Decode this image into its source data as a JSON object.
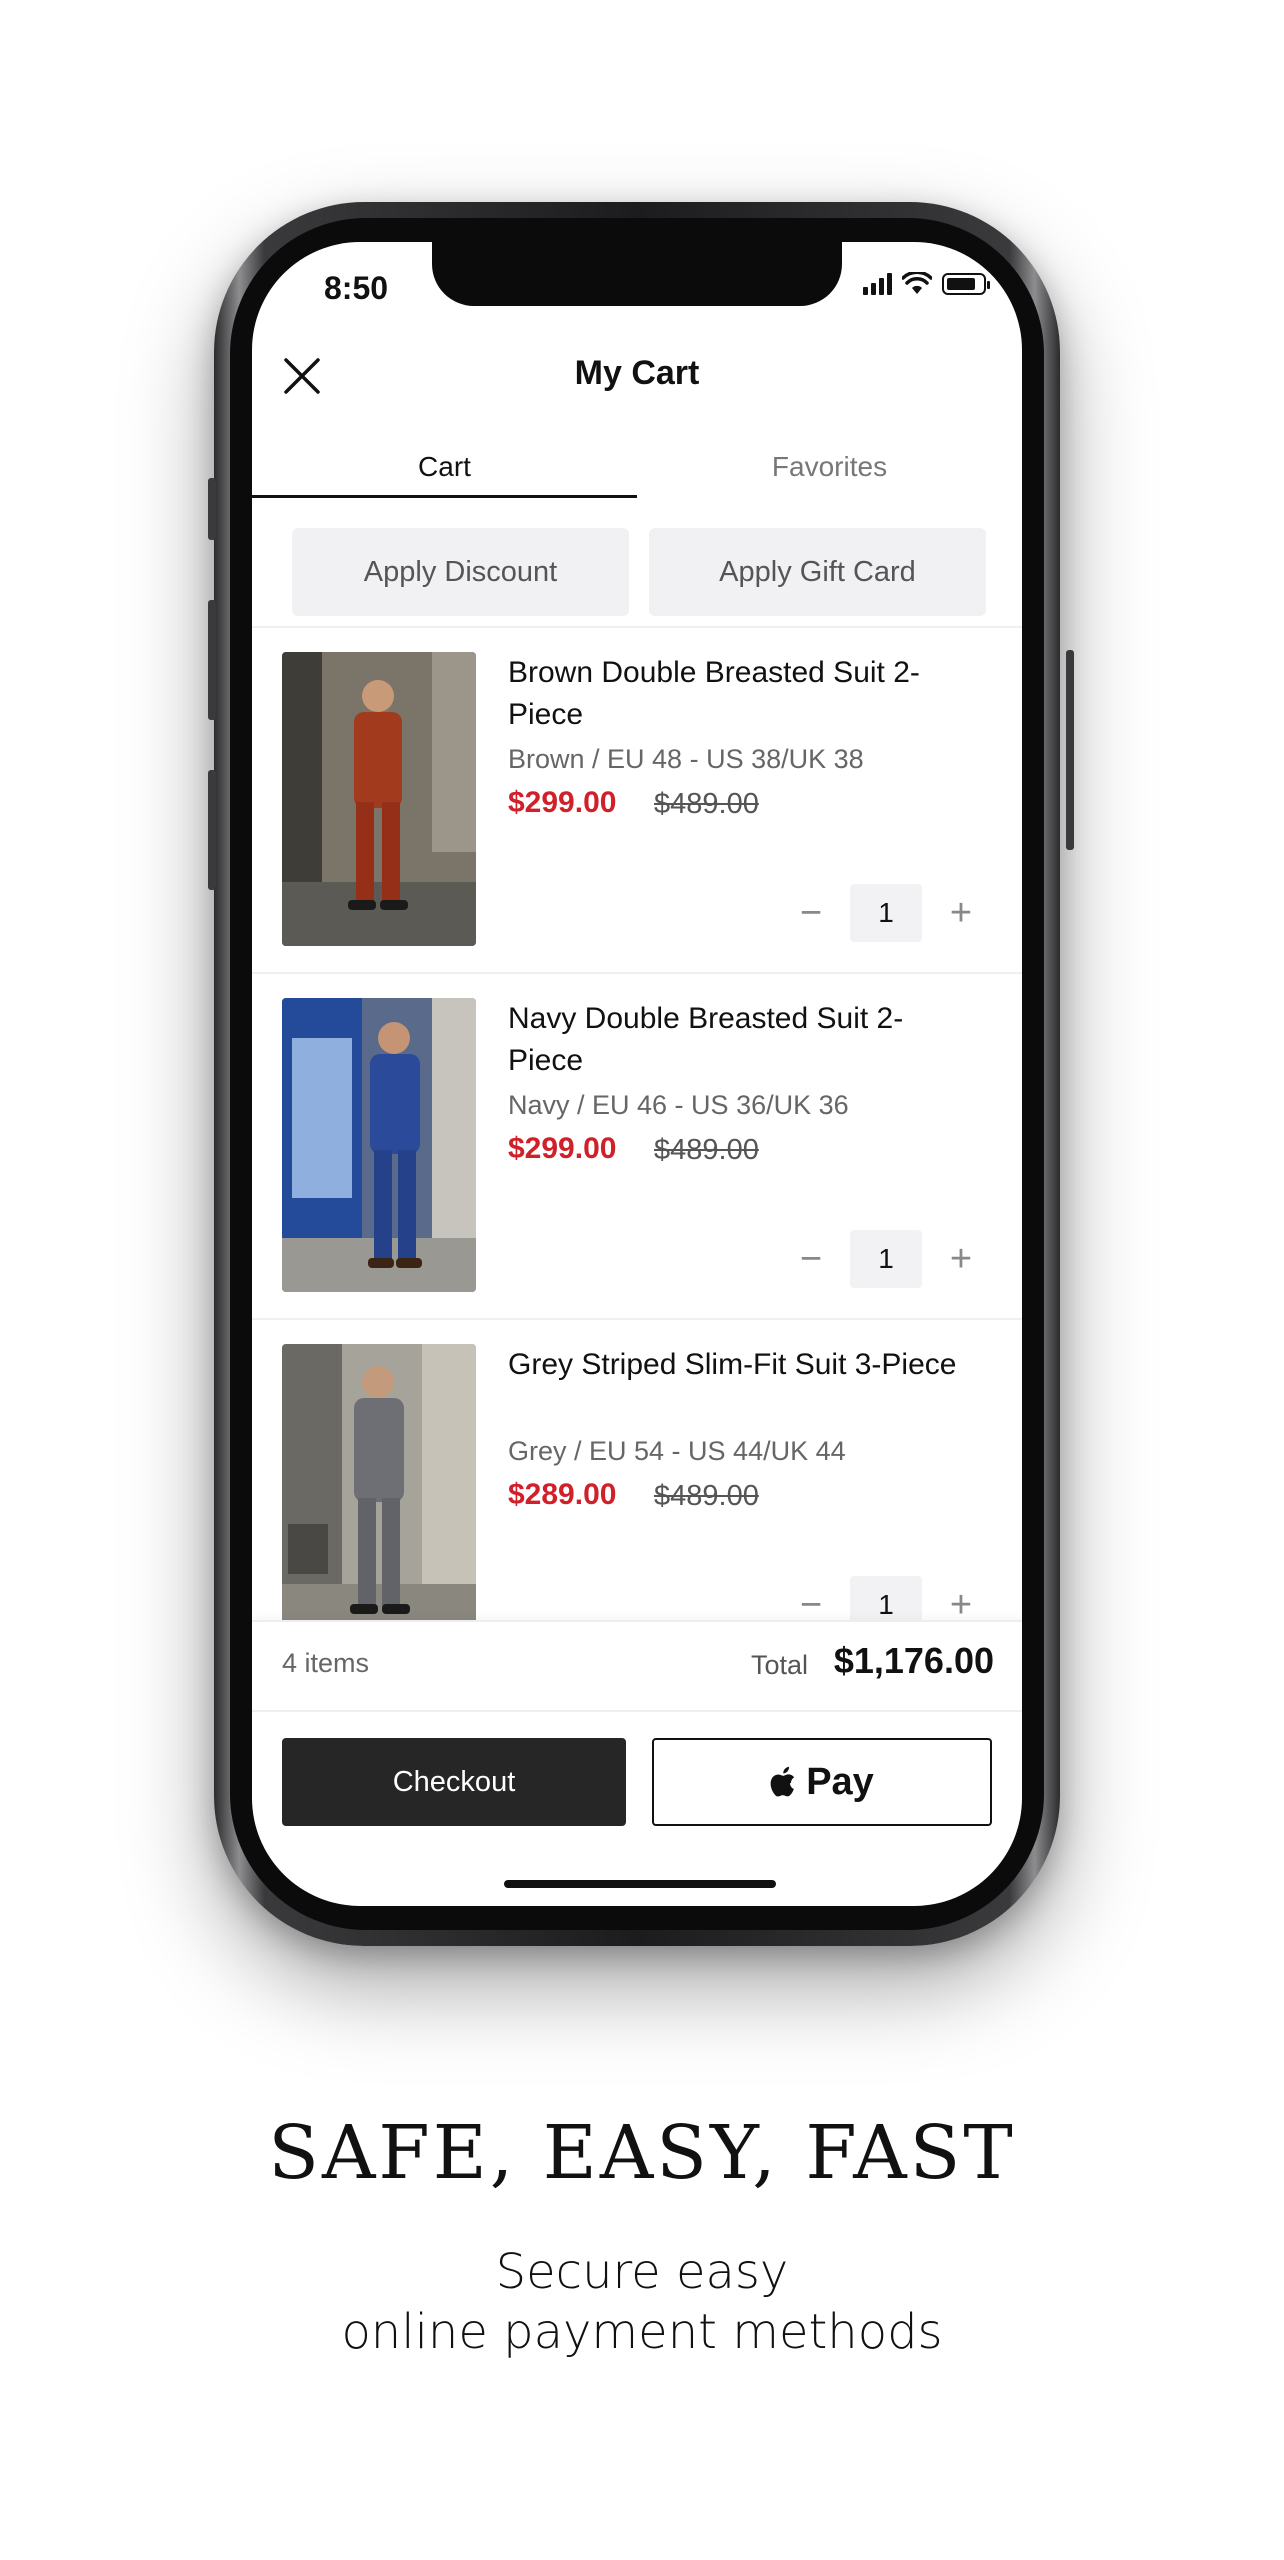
{
  "status_bar": {
    "time": "8:50"
  },
  "header": {
    "title": "My Cart"
  },
  "tabs": [
    {
      "label": "Cart",
      "active": true
    },
    {
      "label": "Favorites",
      "active": false
    }
  ],
  "actions": {
    "discount_label": "Apply Discount",
    "giftcard_label": "Apply Gift Card"
  },
  "items": [
    {
      "name": "Brown Double Breasted Suit 2-Piece",
      "variant": "Brown / EU 48 - US 38/UK 38",
      "price": "$299.00",
      "old_price": "$489.00",
      "qty": "1",
      "color": "#a23a1e",
      "backdrop": "#6e6a62"
    },
    {
      "name": "Navy Double Breasted Suit 2-Piece",
      "variant": "Navy / EU 46 - US 36/UK 36",
      "price": "$299.00",
      "old_price": "$489.00",
      "qty": "1",
      "color": "#2b4a9a",
      "backdrop": "#2f4a7c"
    },
    {
      "name": "Grey Striped Slim-Fit Suit 3-Piece",
      "variant": "Grey / EU 54 - US 44/UK 44",
      "price": "$289.00",
      "old_price": "$489.00",
      "qty": "1",
      "color": "#6e6f74",
      "backdrop": "#8a8880"
    }
  ],
  "summary": {
    "items_count": "4 items",
    "total_label": "Total",
    "total_value": "$1,176.00"
  },
  "buttons": {
    "checkout_label": "Checkout",
    "applepay_label": "Pay"
  },
  "promo": {
    "headline": "SAFE, EASY, FAST",
    "sub_line_1": "Secure easy",
    "sub_line_2": "online payment methods"
  },
  "colors": {
    "sale_red": "#d0202a",
    "checkout_bg": "#262626"
  }
}
